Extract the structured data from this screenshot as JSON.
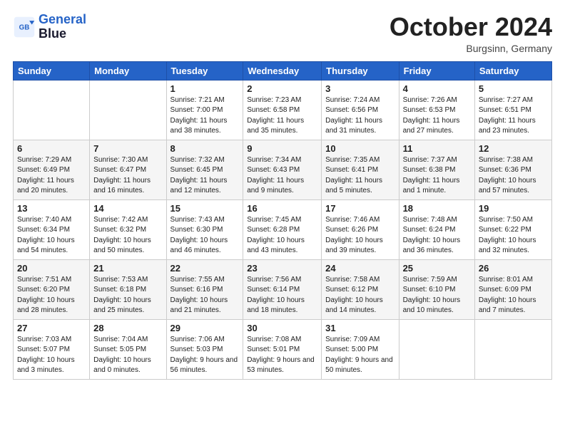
{
  "logo": {
    "line1": "General",
    "line2": "Blue"
  },
  "title": "October 2024",
  "subtitle": "Burgsinn, Germany",
  "days_of_week": [
    "Sunday",
    "Monday",
    "Tuesday",
    "Wednesday",
    "Thursday",
    "Friday",
    "Saturday"
  ],
  "weeks": [
    [
      {
        "day": null,
        "sunrise": null,
        "sunset": null,
        "daylight": null
      },
      {
        "day": null,
        "sunrise": null,
        "sunset": null,
        "daylight": null
      },
      {
        "day": "1",
        "sunrise": "Sunrise: 7:21 AM",
        "sunset": "Sunset: 7:00 PM",
        "daylight": "Daylight: 11 hours and 38 minutes."
      },
      {
        "day": "2",
        "sunrise": "Sunrise: 7:23 AM",
        "sunset": "Sunset: 6:58 PM",
        "daylight": "Daylight: 11 hours and 35 minutes."
      },
      {
        "day": "3",
        "sunrise": "Sunrise: 7:24 AM",
        "sunset": "Sunset: 6:56 PM",
        "daylight": "Daylight: 11 hours and 31 minutes."
      },
      {
        "day": "4",
        "sunrise": "Sunrise: 7:26 AM",
        "sunset": "Sunset: 6:53 PM",
        "daylight": "Daylight: 11 hours and 27 minutes."
      },
      {
        "day": "5",
        "sunrise": "Sunrise: 7:27 AM",
        "sunset": "Sunset: 6:51 PM",
        "daylight": "Daylight: 11 hours and 23 minutes."
      }
    ],
    [
      {
        "day": "6",
        "sunrise": "Sunrise: 7:29 AM",
        "sunset": "Sunset: 6:49 PM",
        "daylight": "Daylight: 11 hours and 20 minutes."
      },
      {
        "day": "7",
        "sunrise": "Sunrise: 7:30 AM",
        "sunset": "Sunset: 6:47 PM",
        "daylight": "Daylight: 11 hours and 16 minutes."
      },
      {
        "day": "8",
        "sunrise": "Sunrise: 7:32 AM",
        "sunset": "Sunset: 6:45 PM",
        "daylight": "Daylight: 11 hours and 12 minutes."
      },
      {
        "day": "9",
        "sunrise": "Sunrise: 7:34 AM",
        "sunset": "Sunset: 6:43 PM",
        "daylight": "Daylight: 11 hours and 9 minutes."
      },
      {
        "day": "10",
        "sunrise": "Sunrise: 7:35 AM",
        "sunset": "Sunset: 6:41 PM",
        "daylight": "Daylight: 11 hours and 5 minutes."
      },
      {
        "day": "11",
        "sunrise": "Sunrise: 7:37 AM",
        "sunset": "Sunset: 6:38 PM",
        "daylight": "Daylight: 11 hours and 1 minute."
      },
      {
        "day": "12",
        "sunrise": "Sunrise: 7:38 AM",
        "sunset": "Sunset: 6:36 PM",
        "daylight": "Daylight: 10 hours and 57 minutes."
      }
    ],
    [
      {
        "day": "13",
        "sunrise": "Sunrise: 7:40 AM",
        "sunset": "Sunset: 6:34 PM",
        "daylight": "Daylight: 10 hours and 54 minutes."
      },
      {
        "day": "14",
        "sunrise": "Sunrise: 7:42 AM",
        "sunset": "Sunset: 6:32 PM",
        "daylight": "Daylight: 10 hours and 50 minutes."
      },
      {
        "day": "15",
        "sunrise": "Sunrise: 7:43 AM",
        "sunset": "Sunset: 6:30 PM",
        "daylight": "Daylight: 10 hours and 46 minutes."
      },
      {
        "day": "16",
        "sunrise": "Sunrise: 7:45 AM",
        "sunset": "Sunset: 6:28 PM",
        "daylight": "Daylight: 10 hours and 43 minutes."
      },
      {
        "day": "17",
        "sunrise": "Sunrise: 7:46 AM",
        "sunset": "Sunset: 6:26 PM",
        "daylight": "Daylight: 10 hours and 39 minutes."
      },
      {
        "day": "18",
        "sunrise": "Sunrise: 7:48 AM",
        "sunset": "Sunset: 6:24 PM",
        "daylight": "Daylight: 10 hours and 36 minutes."
      },
      {
        "day": "19",
        "sunrise": "Sunrise: 7:50 AM",
        "sunset": "Sunset: 6:22 PM",
        "daylight": "Daylight: 10 hours and 32 minutes."
      }
    ],
    [
      {
        "day": "20",
        "sunrise": "Sunrise: 7:51 AM",
        "sunset": "Sunset: 6:20 PM",
        "daylight": "Daylight: 10 hours and 28 minutes."
      },
      {
        "day": "21",
        "sunrise": "Sunrise: 7:53 AM",
        "sunset": "Sunset: 6:18 PM",
        "daylight": "Daylight: 10 hours and 25 minutes."
      },
      {
        "day": "22",
        "sunrise": "Sunrise: 7:55 AM",
        "sunset": "Sunset: 6:16 PM",
        "daylight": "Daylight: 10 hours and 21 minutes."
      },
      {
        "day": "23",
        "sunrise": "Sunrise: 7:56 AM",
        "sunset": "Sunset: 6:14 PM",
        "daylight": "Daylight: 10 hours and 18 minutes."
      },
      {
        "day": "24",
        "sunrise": "Sunrise: 7:58 AM",
        "sunset": "Sunset: 6:12 PM",
        "daylight": "Daylight: 10 hours and 14 minutes."
      },
      {
        "day": "25",
        "sunrise": "Sunrise: 7:59 AM",
        "sunset": "Sunset: 6:10 PM",
        "daylight": "Daylight: 10 hours and 10 minutes."
      },
      {
        "day": "26",
        "sunrise": "Sunrise: 8:01 AM",
        "sunset": "Sunset: 6:09 PM",
        "daylight": "Daylight: 10 hours and 7 minutes."
      }
    ],
    [
      {
        "day": "27",
        "sunrise": "Sunrise: 7:03 AM",
        "sunset": "Sunset: 5:07 PM",
        "daylight": "Daylight: 10 hours and 3 minutes."
      },
      {
        "day": "28",
        "sunrise": "Sunrise: 7:04 AM",
        "sunset": "Sunset: 5:05 PM",
        "daylight": "Daylight: 10 hours and 0 minutes."
      },
      {
        "day": "29",
        "sunrise": "Sunrise: 7:06 AM",
        "sunset": "Sunset: 5:03 PM",
        "daylight": "Daylight: 9 hours and 56 minutes."
      },
      {
        "day": "30",
        "sunrise": "Sunrise: 7:08 AM",
        "sunset": "Sunset: 5:01 PM",
        "daylight": "Daylight: 9 hours and 53 minutes."
      },
      {
        "day": "31",
        "sunrise": "Sunrise: 7:09 AM",
        "sunset": "Sunset: 5:00 PM",
        "daylight": "Daylight: 9 hours and 50 minutes."
      },
      {
        "day": null,
        "sunrise": null,
        "sunset": null,
        "daylight": null
      },
      {
        "day": null,
        "sunrise": null,
        "sunset": null,
        "daylight": null
      }
    ]
  ]
}
